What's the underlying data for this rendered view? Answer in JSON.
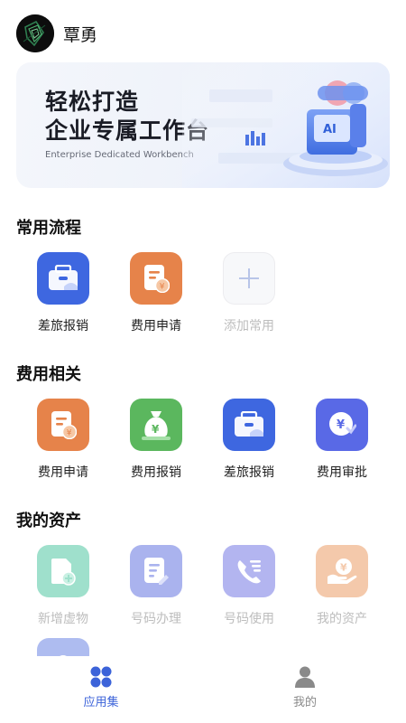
{
  "header": {
    "username": "覃勇"
  },
  "banner": {
    "title_line1": "轻松打造",
    "title_line2": "企业专属工作台",
    "subtitle": "Enterprise Dedicated Workbench",
    "art_label": "AI"
  },
  "sections": {
    "common": {
      "title": "常用流程",
      "items": [
        {
          "label": "差旅报销",
          "icon": "briefcase-icon",
          "color": "#3e67e0"
        },
        {
          "label": "费用申请",
          "icon": "receipt-icon",
          "color": "#e6834a"
        },
        {
          "label": "添加常用",
          "icon": "plus-icon",
          "color": "#f7f8fa"
        }
      ]
    },
    "expense": {
      "title": "费用相关",
      "items": [
        {
          "label": "费用申请",
          "icon": "receipt-icon",
          "color": "#e6834a"
        },
        {
          "label": "费用报销",
          "icon": "money-bag-icon",
          "color": "#5bb75e"
        },
        {
          "label": "差旅报销",
          "icon": "briefcase-icon",
          "color": "#3e67e0"
        },
        {
          "label": "费用审批",
          "icon": "approval-icon",
          "color": "#5969e6"
        }
      ]
    },
    "assets": {
      "title": "我的资产",
      "items": [
        {
          "label": "新增虚物",
          "icon": "new-document-icon",
          "color": "#9fe0cc"
        },
        {
          "label": "号码办理",
          "icon": "edit-document-icon",
          "color": "#aab3ee"
        },
        {
          "label": "号码使用",
          "icon": "phone-list-icon",
          "color": "#b3b5f0"
        },
        {
          "label": "我的资产",
          "icon": "hand-coin-icon",
          "color": "#f4c9ab"
        }
      ]
    }
  },
  "tabbar": {
    "apps_label": "应用集",
    "mine_label": "我的",
    "active_color": "#3c63d9",
    "inactive_color": "#8a8a8a"
  }
}
